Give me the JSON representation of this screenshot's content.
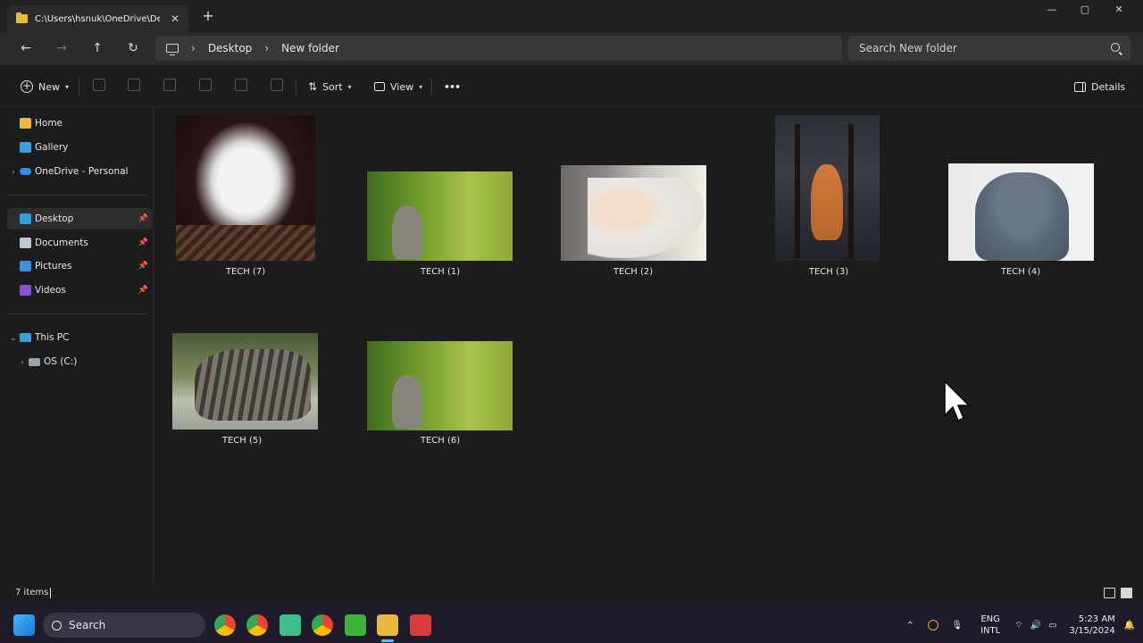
{
  "tab": {
    "title": "C:\\Users\\hsnuk\\OneDrive\\Desk",
    "close": "✕",
    "new_tab": "+"
  },
  "window_controls": {
    "minimize": "—",
    "maximize": "▢",
    "close": "✕"
  },
  "nav": {
    "back": "←",
    "forward": "→",
    "up": "↑",
    "refresh": "↻"
  },
  "breadcrumb": {
    "items": [
      "Desktop",
      "New folder"
    ],
    "separator": "›"
  },
  "search": {
    "placeholder": "Search New folder"
  },
  "commands": {
    "new_label": "New",
    "sort_label": "Sort",
    "view_label": "View",
    "more_label": "•••",
    "details_label": "Details"
  },
  "sidebar": {
    "items": [
      {
        "label": "Home",
        "icon": "home-icon"
      },
      {
        "label": "Gallery",
        "icon": "gallery-icon"
      },
      {
        "label": "OneDrive - Personal",
        "icon": "cloud-icon"
      },
      {
        "label": "Desktop",
        "icon": "desktop-icon",
        "pinned": true
      },
      {
        "label": "Documents",
        "icon": "documents-icon",
        "pinned": true
      },
      {
        "label": "Pictures",
        "icon": "pictures-icon",
        "pinned": true
      },
      {
        "label": "Videos",
        "icon": "videos-icon",
        "pinned": true
      },
      {
        "label": "This PC",
        "icon": "pc-icon"
      },
      {
        "label": "OS (C:)",
        "icon": "drive-icon"
      }
    ]
  },
  "files": [
    {
      "name": "TECH (7)",
      "subject": "white kitten on basket"
    },
    {
      "name": "TECH (1)",
      "subject": "kitten in grass"
    },
    {
      "name": "TECH (2)",
      "subject": "white fluffy cat"
    },
    {
      "name": "TECH (3)",
      "subject": "orange tabby under chair"
    },
    {
      "name": "TECH (4)",
      "subject": "grey british shorthair"
    },
    {
      "name": "TECH (5)",
      "subject": "tabby cat lying"
    },
    {
      "name": "TECH (6)",
      "subject": "kitten in grass"
    }
  ],
  "status": {
    "item_count": "7 items"
  },
  "taskbar": {
    "search_label": "Search",
    "language": "ENG",
    "layout": "INTL",
    "time": "5:23 AM",
    "date": "3/15/2024"
  },
  "colors": {
    "accent": "#4cc2ff",
    "folder": "#e9b840",
    "background": "#1c1c1c"
  }
}
